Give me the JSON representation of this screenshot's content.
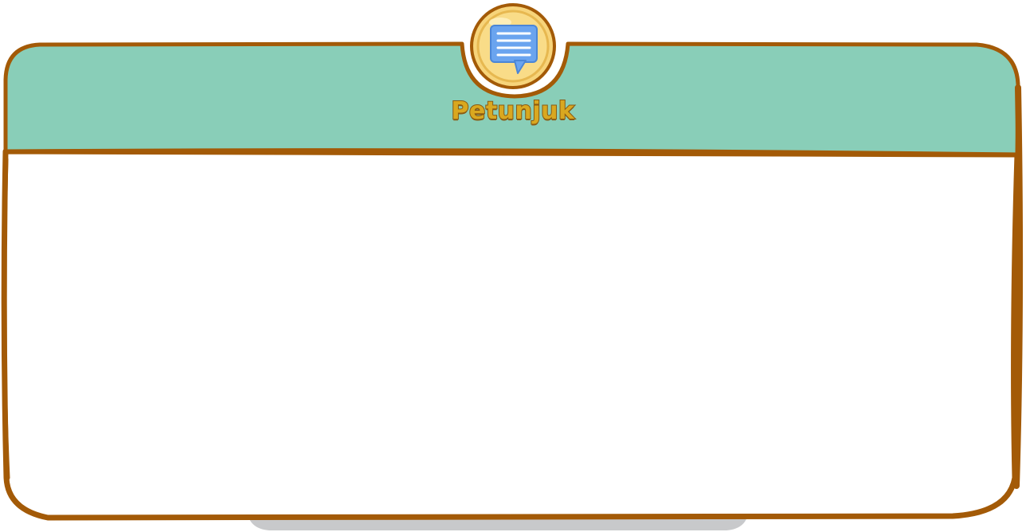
{
  "panel": {
    "title": "Petunjuk",
    "icon": "speech-bubble-icon",
    "body_text": ""
  },
  "colors": {
    "border": "#a35a07",
    "header_fill": "#89ceb8",
    "body_fill": "#ffffff",
    "badge_fill": "#f7d47a",
    "icon_fill": "#6aa4ef",
    "shadow": "#c8c9cb"
  }
}
